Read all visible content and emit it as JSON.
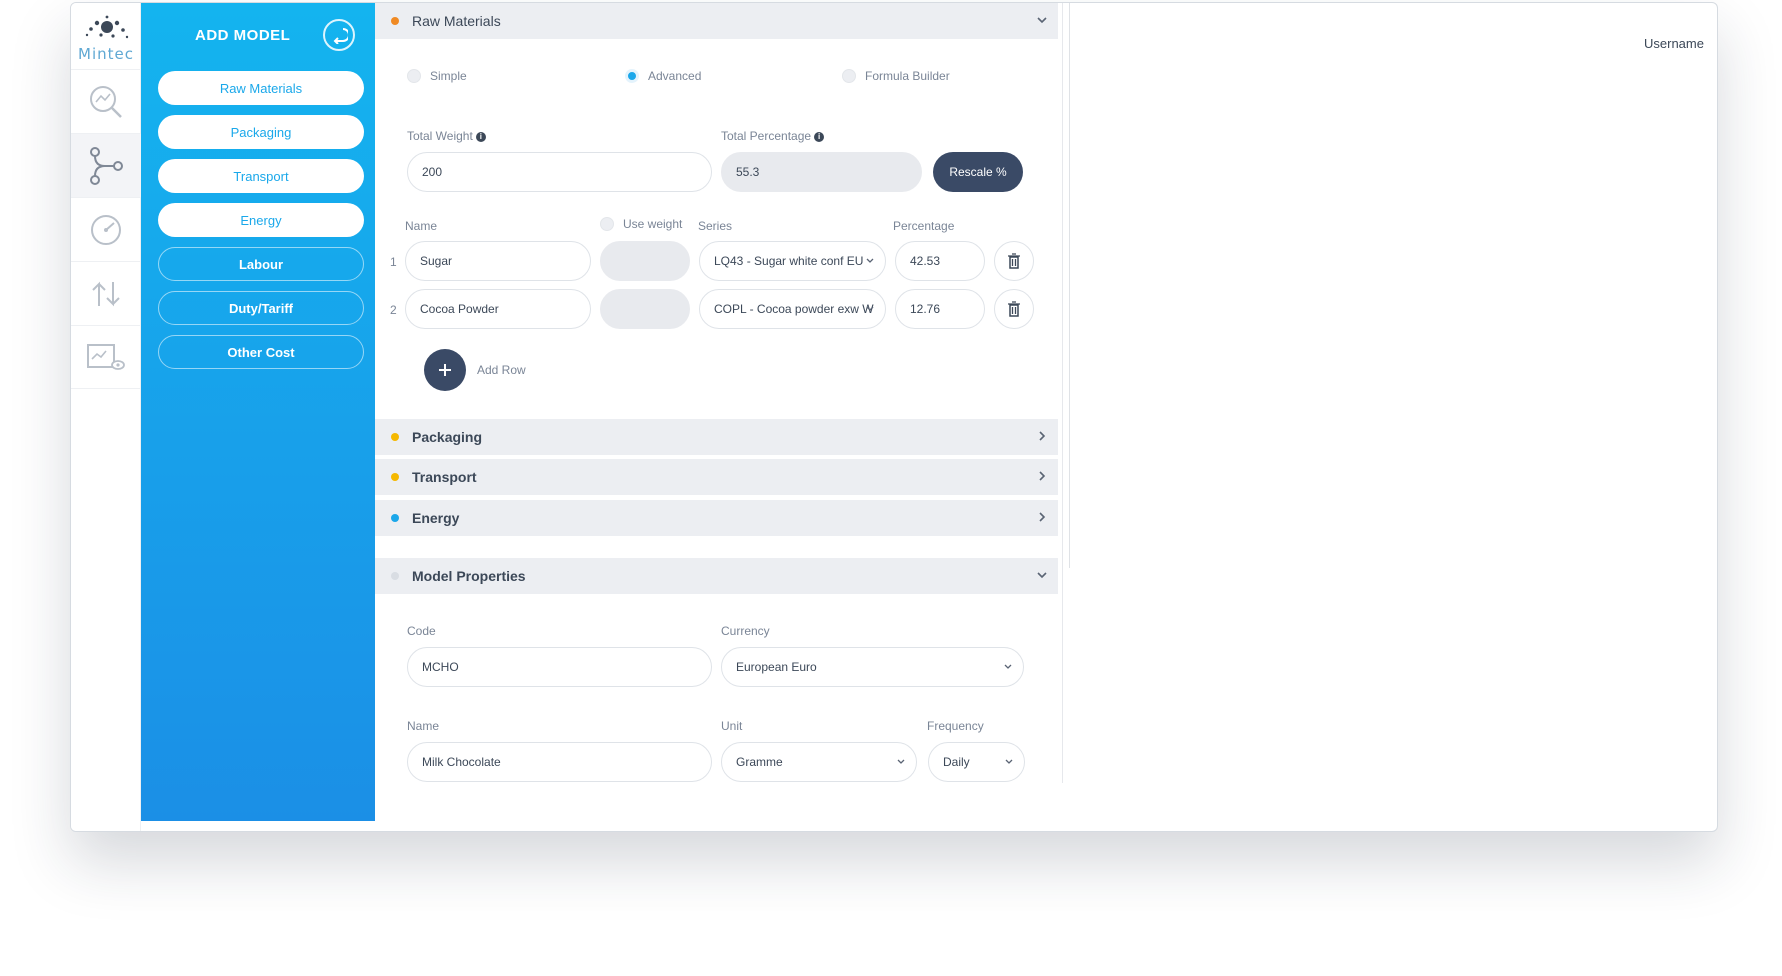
{
  "brand": {
    "name": "Mintec"
  },
  "rail": {
    "items": [
      "search",
      "model",
      "gauge",
      "transfer",
      "report-view"
    ]
  },
  "nav": {
    "title": "ADD MODEL",
    "items": [
      {
        "label": "Raw Materials"
      },
      {
        "label": "Packaging"
      },
      {
        "label": "Transport"
      },
      {
        "label": "Energy"
      },
      {
        "label": "Labour"
      },
      {
        "label": "Duty/Tariff"
      },
      {
        "label": "Other Cost"
      }
    ]
  },
  "colors": {
    "orange": "#f08a24",
    "yellow": "#f5b800",
    "blue": "#1ba7ea",
    "grey": "#d9dde3",
    "accent_dark": "#3a4a66"
  },
  "raw": {
    "title": "Raw Materials",
    "modes": {
      "simple": "Simple",
      "advanced": "Advanced",
      "formula": "Formula Builder",
      "selected": "Advanced"
    },
    "total_weight_label": "Total Weight",
    "total_weight": "200",
    "total_percentage_label": "Total Percentage",
    "total_percentage": "55.3",
    "rescale": "Rescale %",
    "col_name": "Name",
    "col_use_weight": "Use weight",
    "col_series": "Series",
    "col_percentage": "Percentage",
    "rows": [
      {
        "num": "1",
        "name": "Sugar",
        "series": "LQ43 - Sugar white  conf EU",
        "percentage": "42.53"
      },
      {
        "num": "2",
        "name": "Cocoa Powder",
        "series": "COPL - Cocoa powder exw W",
        "percentage": "12.76"
      }
    ],
    "add_row": "Add Row"
  },
  "sections": {
    "packaging": "Packaging",
    "transport": "Transport",
    "energy": "Energy"
  },
  "props": {
    "title": "Model Properties",
    "code_label": "Code",
    "code": "MCHO",
    "currency_label": "Currency",
    "currency": "European Euro",
    "name_label": "Name",
    "name": "Milk Chocolate",
    "unit_label": "Unit",
    "unit": "Gramme",
    "frequency_label": "Frequency",
    "frequency": "Daily"
  },
  "header": {
    "username": "Username"
  }
}
